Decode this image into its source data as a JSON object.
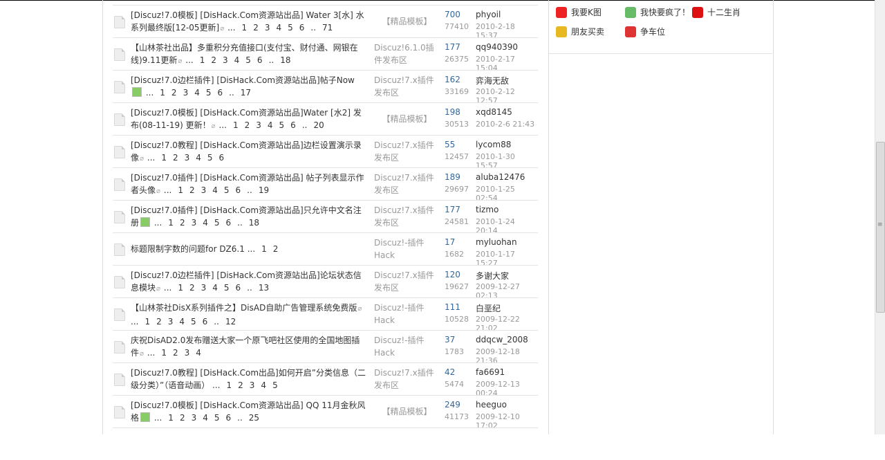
{
  "sidebar_links": [
    {
      "label": "我要K图",
      "icon": "k-image-icon",
      "color": "#e22"
    },
    {
      "label": "我快要疯了！",
      "icon": "crazy-face-icon",
      "color": "#6b6"
    },
    {
      "label": "十二生肖",
      "icon": "dragon-zodiac-icon",
      "color": "#d11"
    },
    {
      "label": "朋友买卖",
      "icon": "coins-icon",
      "color": "#e8b820"
    },
    {
      "label": "争车位",
      "icon": "parking-icon",
      "color": "#d33"
    }
  ],
  "threads": [
    {
      "title": "[Discuz!7.0模板] [DisHack.Com资源站出品] Water 3[水] 水系列最终版[12-05更新]",
      "icon": "attachment",
      "pages": [
        "...",
        "1",
        "2",
        "3",
        "4",
        "5",
        "6",
        "..",
        "71"
      ],
      "forum": "【精品模板】",
      "replies": "700",
      "views": "77410",
      "author": "phyoil",
      "date": "2010-2-18 15:37"
    },
    {
      "title": "【山林茶社出品】多重积分充值接口(支付宝、财付通、网银在线)9.11更新",
      "icon": "attachment",
      "pages": [
        "...",
        "1",
        "2",
        "3",
        "4",
        "5",
        "6",
        "..",
        "18"
      ],
      "forum": "Discuz!6.1.0插件发布区",
      "replies": "177",
      "views": "26375",
      "author": "qq940390",
      "date": "2010-2-17 15:04"
    },
    {
      "title": "[Discuz!7.0边栏插件] [DisHack.Com资源站出品]帖子Now",
      "icon": "image",
      "pages": [
        "...",
        "1",
        "2",
        "3",
        "4",
        "5",
        "6",
        "..",
        "17"
      ],
      "forum": "Discuz!7.x插件发布区",
      "replies": "162",
      "views": "33169",
      "author": "弈海无敌",
      "date": "2010-2-12 12:57"
    },
    {
      "title": "[Discuz!7.0模板] [DisHack.Com资源站出品]Water [水2] 发布(08-11-19) 更新！",
      "icon": "attachment",
      "pages": [
        "...",
        "1",
        "2",
        "3",
        "4",
        "5",
        "6",
        "..",
        "20"
      ],
      "forum": "【精品模板】",
      "replies": "198",
      "views": "30513",
      "author": "xqd8145",
      "date": "2010-2-6 21:43"
    },
    {
      "title": "[Discuz!7.0教程] [DisHack.Com资源站出品]边栏设置演示录像",
      "icon": "attachment",
      "pages": [
        "...",
        "1",
        "2",
        "3",
        "4",
        "5",
        "6"
      ],
      "forum": "Discuz!7.x插件发布区",
      "replies": "55",
      "views": "12457",
      "author": "lycom88",
      "date": "2010-1-30 15:57"
    },
    {
      "title": "[Discuz!7.0插件] [DisHack.Com资源站出品] 帖子列表显示作者头像",
      "icon": "attachment",
      "pages": [
        "...",
        "1",
        "2",
        "3",
        "4",
        "5",
        "6",
        "..",
        "19"
      ],
      "forum": "Discuz!7.x插件发布区",
      "replies": "189",
      "views": "29697",
      "author": "aluba12476",
      "date": "2010-1-25 02:54"
    },
    {
      "title": "[Discuz!7.0插件] [DisHack.Com资源站出品]只允许中文名注册",
      "icon": "image",
      "pages": [
        "...",
        "1",
        "2",
        "3",
        "4",
        "5",
        "6",
        "..",
        "18"
      ],
      "forum": "Discuz!7.x插件发布区",
      "replies": "177",
      "views": "24581",
      "author": "tizmo",
      "date": "2010-1-24 20:14"
    },
    {
      "title": "标题限制字数的问题for DZ6.1",
      "icon": "",
      "pages": [
        "...",
        "1",
        "2"
      ],
      "forum": "Discuz!-插件Hack",
      "replies": "17",
      "views": "1682",
      "author": "myluohan",
      "date": "2010-1-17 15:27",
      "single": true
    },
    {
      "title": "[Discuz!7.0边栏插件] [DisHack.Com资源站出品]论坛状态信息模块",
      "icon": "attachment",
      "pages": [
        "...",
        "1",
        "2",
        "3",
        "4",
        "5",
        "6",
        "..",
        "13"
      ],
      "forum": "Discuz!7.x插件发布区",
      "replies": "120",
      "views": "19627",
      "author": "多谢大家",
      "date": "2009-12-27 02:13"
    },
    {
      "title": "【山林茶社DisX系列插件之】DisAD自助广告管理系统免费版",
      "icon": "attachment",
      "pages": [
        "...",
        "1",
        "2",
        "3",
        "4",
        "5",
        "6",
        "..",
        "12"
      ],
      "forum": "Discuz!-插件Hack",
      "replies": "111",
      "views": "10528",
      "author": "白垩纪",
      "date": "2009-12-22 21:02"
    },
    {
      "title": "庆祝DisAD2.0发布赠送大家一个原飞吧社区使用的全国地图插件",
      "icon": "attachment",
      "pages": [
        "...",
        "1",
        "2",
        "3",
        "4"
      ],
      "forum": "Discuz!-插件Hack",
      "replies": "37",
      "views": "1783",
      "author": "ddqcw_2008",
      "date": "2009-12-18 21:36"
    },
    {
      "title": "[Discuz!7.0教程] [DisHack.Com出品]如何开启”分类信息（二级分类）”（语音动画）",
      "icon": "",
      "pages": [
        "...",
        "1",
        "2",
        "3",
        "4",
        "5"
      ],
      "forum": "Discuz!7.x插件发布区",
      "replies": "42",
      "views": "5474",
      "author": "fa6691",
      "date": "2009-12-13 00:24"
    },
    {
      "title": "[Discuz!7.0模板] [DisHack.Com资源站出品] QQ 11月金秋风格",
      "icon": "image",
      "pages": [
        "...",
        "1",
        "2",
        "3",
        "4",
        "5",
        "6",
        "..",
        "25"
      ],
      "forum": "【精品模板】",
      "replies": "249",
      "views": "41173",
      "author": "heeguo",
      "date": "2009-12-10 17:02"
    }
  ]
}
